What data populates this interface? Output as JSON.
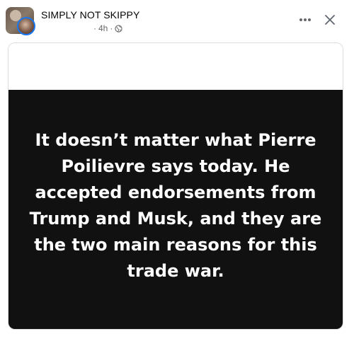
{
  "post": {
    "group_name": "SIMPLY NOT SKIPPY",
    "time": "4h",
    "separator": "·",
    "privacy_icon": "globe-icon",
    "more_icon": "more-options-icon",
    "close_icon": "close-icon",
    "quote": "It doesn’t matter what Pierre Poilievre says today. He accepted endorsements from Trump and Musk, and they are the two main reasons for this trade war."
  },
  "colors": {
    "text_primary": "#050505",
    "text_secondary": "#65676b",
    "panel_background": "#111111",
    "avatar_ring": "#1877f2"
  }
}
